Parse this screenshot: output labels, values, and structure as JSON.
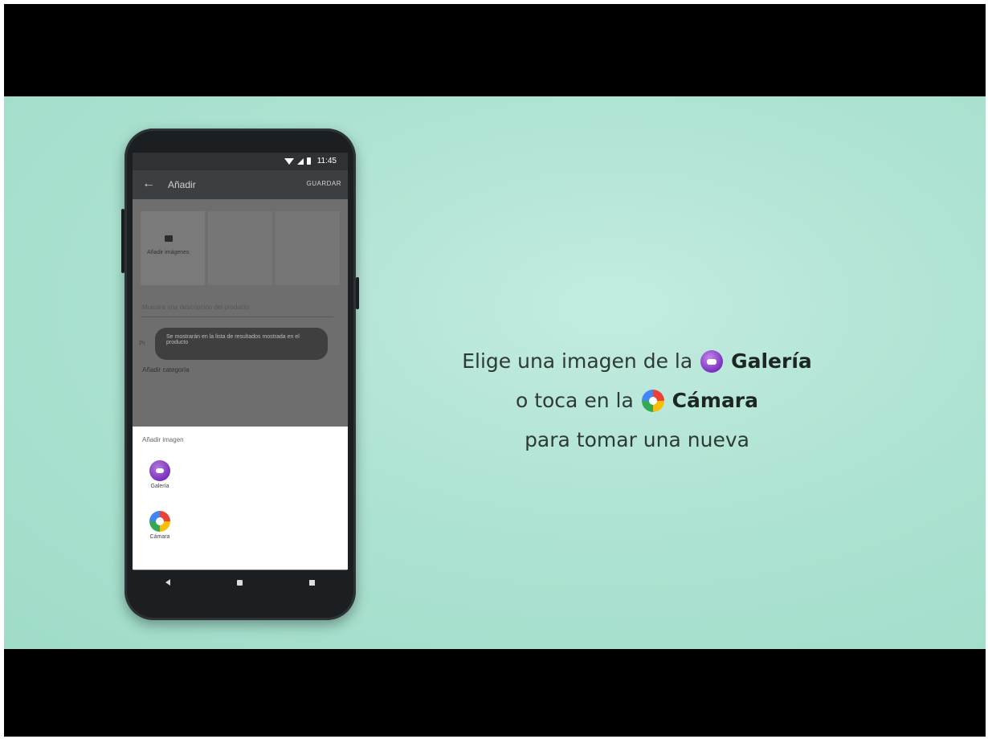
{
  "phone": {
    "status_time": "11:45",
    "appbar": {
      "title": "Añadir",
      "action": "GUARDAR",
      "back_icon": "arrow-back-icon"
    },
    "thumb_label": "Añadir imágenes",
    "field_placeholder": "Muestra una descripción del producto",
    "toast_text": "Se mostrarán en la lista de resultados mostrada en el producto",
    "small_label": "Añadir categoría",
    "sheet": {
      "title": "Añadir imagen",
      "items": [
        {
          "label": "Galería",
          "icon": "gallery-icon"
        },
        {
          "label": "Cámara",
          "icon": "camera-icon"
        }
      ]
    }
  },
  "caption": {
    "line1_prefix": "Elige una imagen de la",
    "line1_bold": "Galería",
    "line2_prefix": "o toca en la",
    "line2_bold": "Cámara",
    "line3": "para tomar una nueva"
  },
  "colors": {
    "background": "#aee3d3",
    "gallery_purple": "#7a2fbd",
    "phone_body": "#1c1f22"
  }
}
